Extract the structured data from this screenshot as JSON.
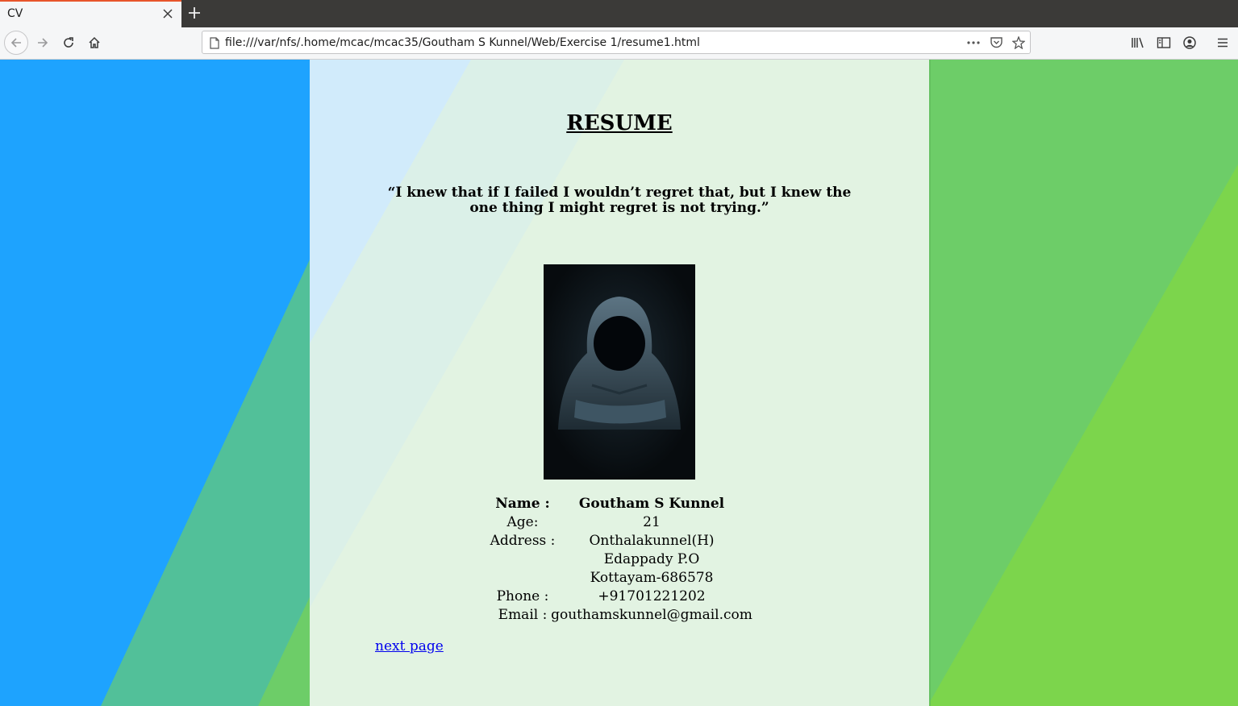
{
  "browser": {
    "tab_title": "CV",
    "url": "file:///var/nfs/.home/mcac/mcac35/Goutham S Kunnel/Web/Exercise 1/resume1.html"
  },
  "page": {
    "title": "RESUME",
    "quote": "“I knew that if I failed I wouldn’t regret that, but I knew the one thing I might regret is not trying.”",
    "photo_icon": "hooded-figure-photo",
    "info": {
      "name_label": "Name :",
      "name_value": "Goutham S Kunnel",
      "age_label": "Age:",
      "age_value": "21",
      "address_label": "Address :",
      "address_lines": [
        "Onthalakunnel(H)",
        "Edappady P.O",
        "Kottayam-686578"
      ],
      "phone_label": "Phone :",
      "phone_value": "+91701221202",
      "email_label": "Email :",
      "email_value": "gouthamskunnel@gmail.com"
    },
    "next_link": "next page"
  },
  "colors": {
    "bg_blue": "#1ea3fe",
    "bg_teal": "#52c099",
    "bg_green": "#6dcd68",
    "bg_lime": "#7cd54c",
    "card_bg": "#e2f3e2",
    "link": "#0000ee"
  }
}
